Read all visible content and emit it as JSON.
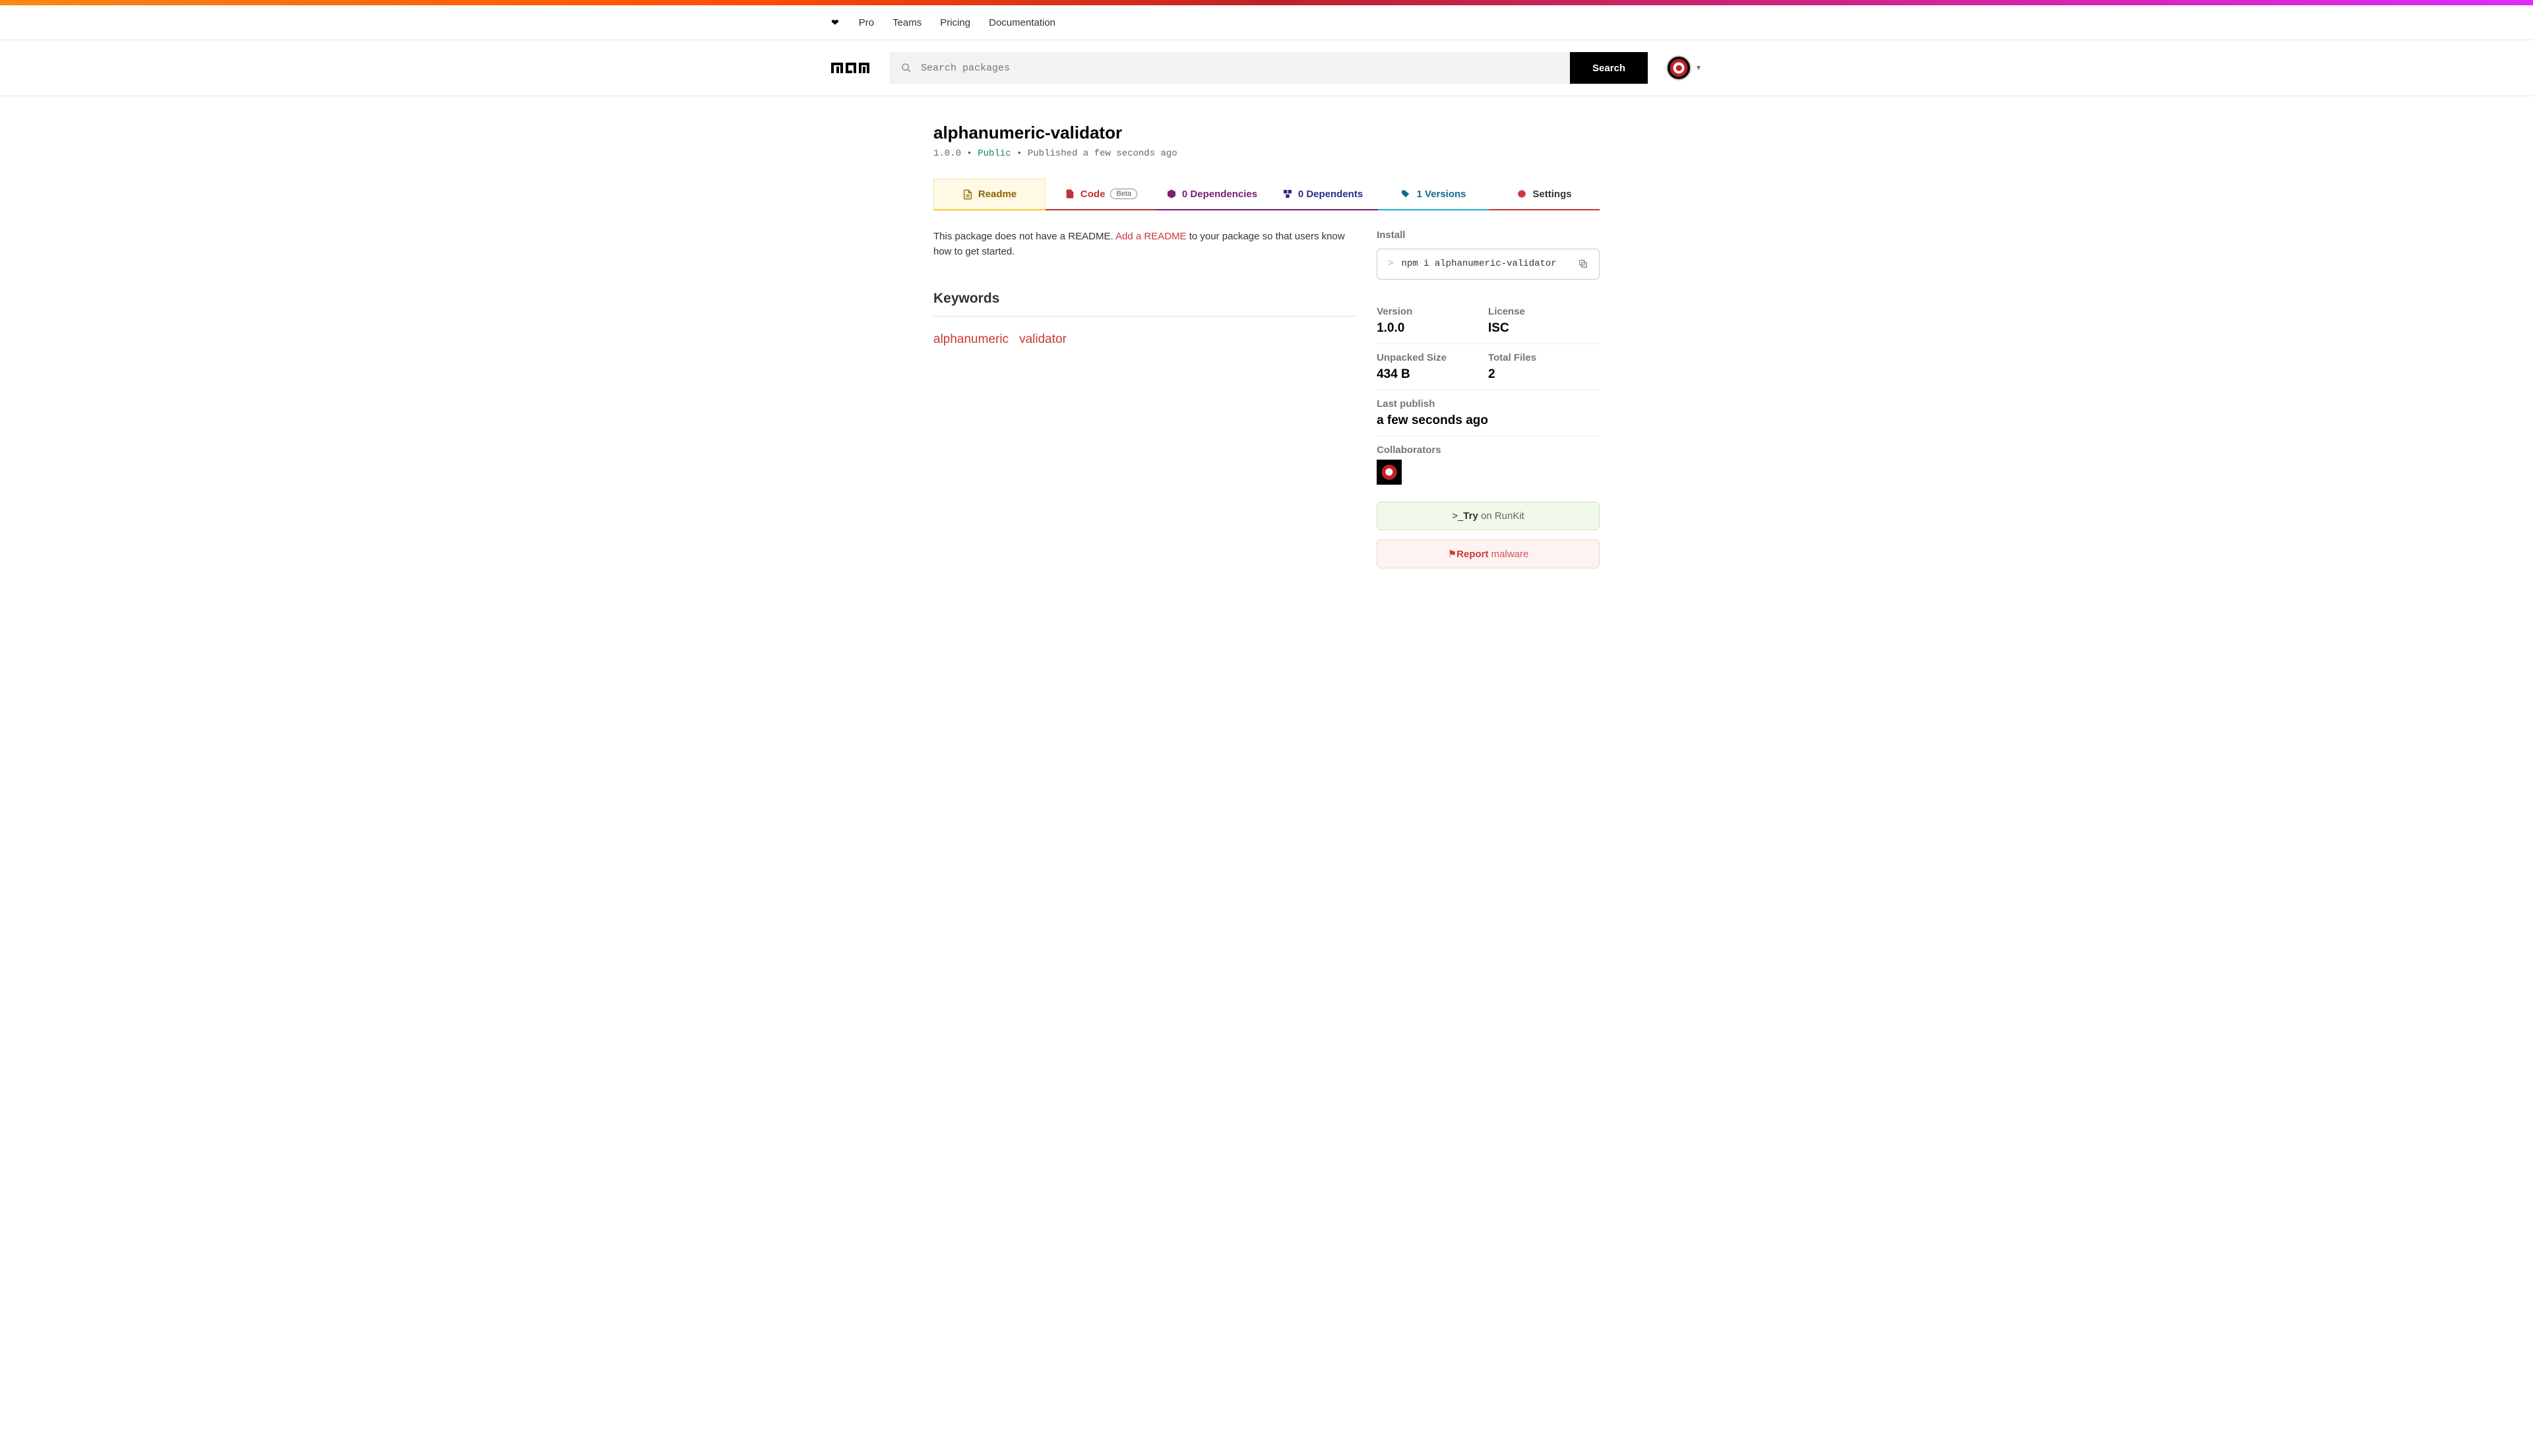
{
  "nav": {
    "links": [
      "Pro",
      "Teams",
      "Pricing",
      "Documentation"
    ]
  },
  "search": {
    "placeholder": "Search packages",
    "button": "Search"
  },
  "package": {
    "name": "alphanumeric-validator",
    "version": "1.0.0",
    "visibility": "Public",
    "published": "Published a few seconds ago"
  },
  "tabs": {
    "readme": "Readme",
    "code": "Code",
    "code_badge": "Beta",
    "dependencies": "0 Dependencies",
    "dependents": "0 Dependents",
    "versions": "1 Versions",
    "settings": "Settings"
  },
  "readme": {
    "pre": "This package does not have a README. ",
    "link": "Add a README",
    "post": " to your package so that users know how to get started."
  },
  "keywords": {
    "title": "Keywords",
    "items": [
      "alphanumeric",
      "validator"
    ]
  },
  "sidebar": {
    "install_label": "Install",
    "install_cmd": "npm i alphanumeric-validator",
    "version_label": "Version",
    "version": "1.0.0",
    "license_label": "License",
    "license": "ISC",
    "size_label": "Unpacked Size",
    "size": "434 B",
    "files_label": "Total Files",
    "files": "2",
    "last_publish_label": "Last publish",
    "last_publish": "a few seconds ago",
    "collaborators_label": "Collaborators",
    "runkit_try": "Try",
    "runkit_on": " on RunKit",
    "report_bold": "Report",
    "report_light": " malware"
  }
}
